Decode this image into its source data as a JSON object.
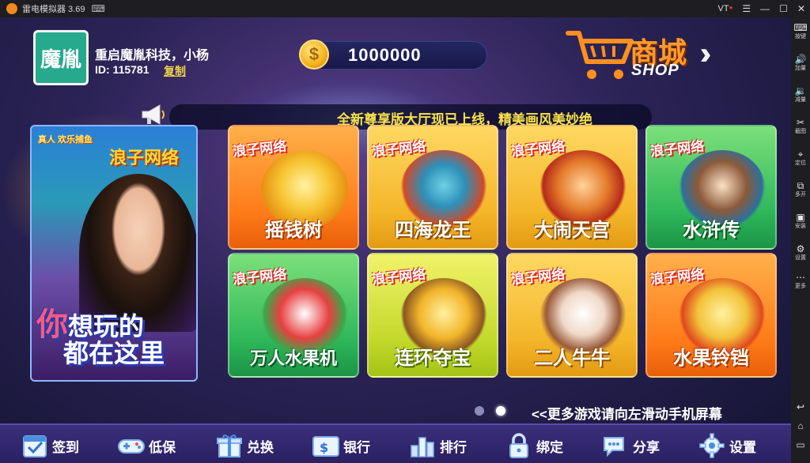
{
  "window": {
    "title": "雷电模拟器 3.69",
    "vt_label": "VT",
    "vt_dot": "●"
  },
  "sidebar": {
    "items": [
      {
        "icon": "keyboard-icon",
        "label": "按键"
      },
      {
        "icon": "volume-up-icon",
        "label": "加量"
      },
      {
        "icon": "volume-down-icon",
        "label": "减量"
      },
      {
        "icon": "scissors-icon",
        "label": "截图"
      },
      {
        "icon": "location-pin-icon",
        "label": "定位"
      },
      {
        "icon": "multi-window-icon",
        "label": "多开"
      },
      {
        "icon": "apk-install-icon",
        "label": "安装"
      },
      {
        "icon": "gear-icon",
        "label": "设置"
      },
      {
        "icon": "more-icon",
        "label": "更多"
      }
    ]
  },
  "profile": {
    "avatar_text": "魔胤",
    "name": "重启魔胤科技，小杨",
    "id_text": "ID: 115781",
    "copy_label": "复制"
  },
  "coins": {
    "symbol": "$",
    "value": "1000000"
  },
  "shop": {
    "cn": "商城",
    "en": "SHOP",
    "arrows": "›››"
  },
  "marquee": {
    "text": "全新尊享版大厅现已上线，精美画风美妙绝"
  },
  "banner": {
    "top_label": "真人 欢乐捕鱼",
    "logo": "浪子网络",
    "line1_big": "你",
    "line1_rest": "想玩的",
    "line2": "都在这里"
  },
  "tiles": [
    {
      "brand": "浪子网络",
      "name": "摇钱树"
    },
    {
      "brand": "浪子网络",
      "name": "四海龙王"
    },
    {
      "brand": "浪子网络",
      "name": "大闹天宫"
    },
    {
      "brand": "浪子网络",
      "name": "水浒传"
    },
    {
      "brand": "浪子网络",
      "name": "万人水果机"
    },
    {
      "brand": "浪子网络",
      "name": "连环夺宝"
    },
    {
      "brand": "浪子网络",
      "name": "二人牛牛"
    },
    {
      "brand": "浪子网络",
      "name": "水果铃铛"
    }
  ],
  "pagination": {
    "total": 2,
    "active": 2,
    "hint": "<<更多游戏请向左滑动手机屏幕"
  },
  "bottom_nav": [
    {
      "icon": "calendar-check-icon",
      "label": "签到"
    },
    {
      "icon": "gamepad-icon",
      "label": "低保"
    },
    {
      "icon": "gift-icon",
      "label": "兑换"
    },
    {
      "icon": "bank-card-icon",
      "label": "银行"
    },
    {
      "icon": "ranking-bars-icon",
      "label": "排行"
    },
    {
      "icon": "lock-icon",
      "label": "绑定"
    },
    {
      "icon": "chat-bubble-icon",
      "label": "分享"
    },
    {
      "icon": "gear-icon",
      "label": "设置"
    }
  ],
  "colors": {
    "accent_yellow": "#f8e24a",
    "shop_orange": "#ff9a2a",
    "avatar_teal": "#27a98e",
    "bottom_bar": "#2a2063"
  }
}
